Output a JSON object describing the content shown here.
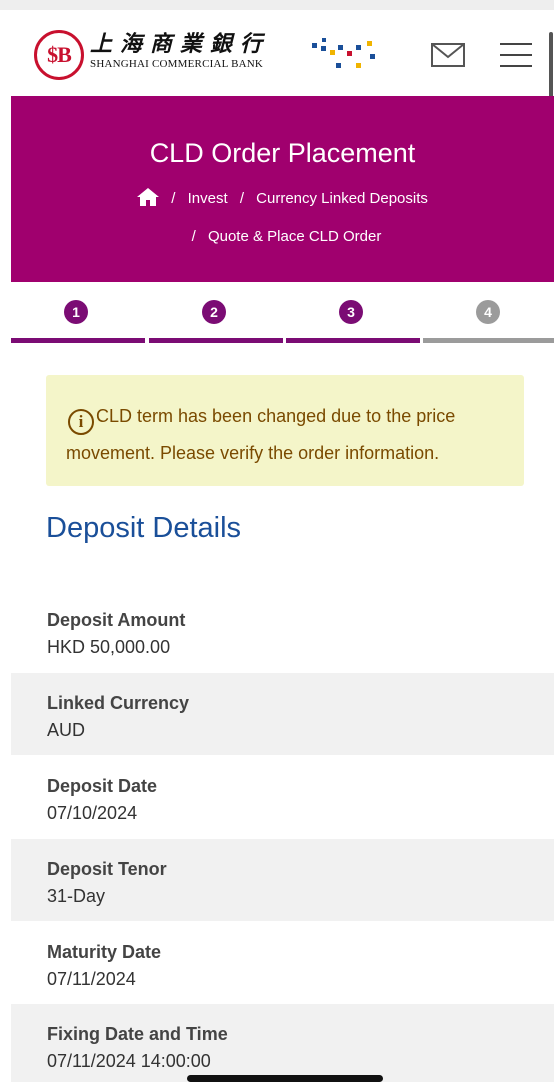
{
  "header": {
    "logo_mark": "$B",
    "logo_chinese": "上海商業銀行",
    "logo_english": "SHANGHAI COMMERCIAL BANK",
    "icons": [
      "bank-logo-icon",
      "mail-icon",
      "menu-icon"
    ]
  },
  "banner": {
    "title": "CLD Order Placement",
    "breadcrumb": [
      "Invest",
      "Currency Linked Deposits",
      "Quote & Place CLD Order"
    ],
    "separator": "/",
    "color": "#a0006e"
  },
  "steps": [
    {
      "number": "1",
      "state": "done"
    },
    {
      "number": "2",
      "state": "done"
    },
    {
      "number": "3",
      "state": "current"
    },
    {
      "number": "4",
      "state": "pending"
    }
  ],
  "step_colors": {
    "active": "#7b0c74",
    "pending": "#9b9b9b"
  },
  "alert": {
    "icon": "info-icon",
    "message": "CLD term has been changed due to the price movement. Please verify the order information."
  },
  "deposit_details": {
    "title": "Deposit Details",
    "fields": [
      {
        "label": "Deposit Amount",
        "value": "HKD  50,000.00"
      },
      {
        "label": "Linked Currency",
        "value": "AUD"
      },
      {
        "label": "Deposit Date",
        "value": "07/10/2024"
      },
      {
        "label": "Deposit Tenor",
        "value": "31-Day"
      },
      {
        "label": "Maturity Date",
        "value": "07/11/2024"
      },
      {
        "label": "Fixing Date and Time",
        "value": "07/11/2024 14:00:00"
      }
    ]
  }
}
